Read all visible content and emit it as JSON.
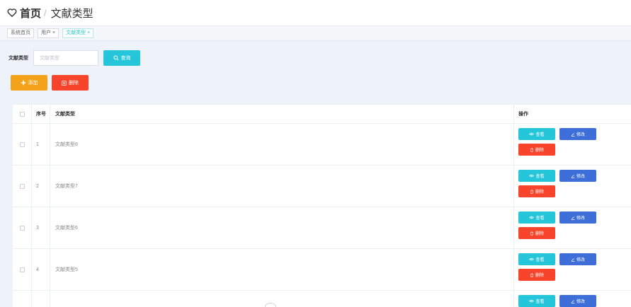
{
  "header": {
    "home": "首页",
    "separator": "/",
    "title": "文献类型"
  },
  "tabs": [
    {
      "label": "系统首页",
      "closable": false,
      "active": false
    },
    {
      "label": "用户",
      "closable": true,
      "active": false
    },
    {
      "label": "文献类型",
      "closable": true,
      "active": true
    }
  ],
  "tab_close_glyph": "×",
  "search": {
    "label": "文献类型",
    "placeholder": "文献类型",
    "value": "",
    "button": "查询"
  },
  "toolbar": {
    "add": "添加",
    "delete": "删除"
  },
  "table": {
    "columns": {
      "index": "序号",
      "name": "文献类型",
      "actions": "操作"
    },
    "rows": [
      {
        "index": "1",
        "name": "文献类型8"
      },
      {
        "index": "2",
        "name": "文献类型7"
      },
      {
        "index": "3",
        "name": "文献类型6"
      },
      {
        "index": "4",
        "name": "文献类型5"
      },
      {
        "index": "",
        "name": ""
      }
    ],
    "row_actions": {
      "view": "查看",
      "edit": "修改",
      "delete": "删除"
    }
  },
  "colors": {
    "teal": "#26c6da",
    "blue": "#3e6fd8",
    "orange": "#f5a21b",
    "red": "#f8442a",
    "background": "#eef3fa"
  }
}
